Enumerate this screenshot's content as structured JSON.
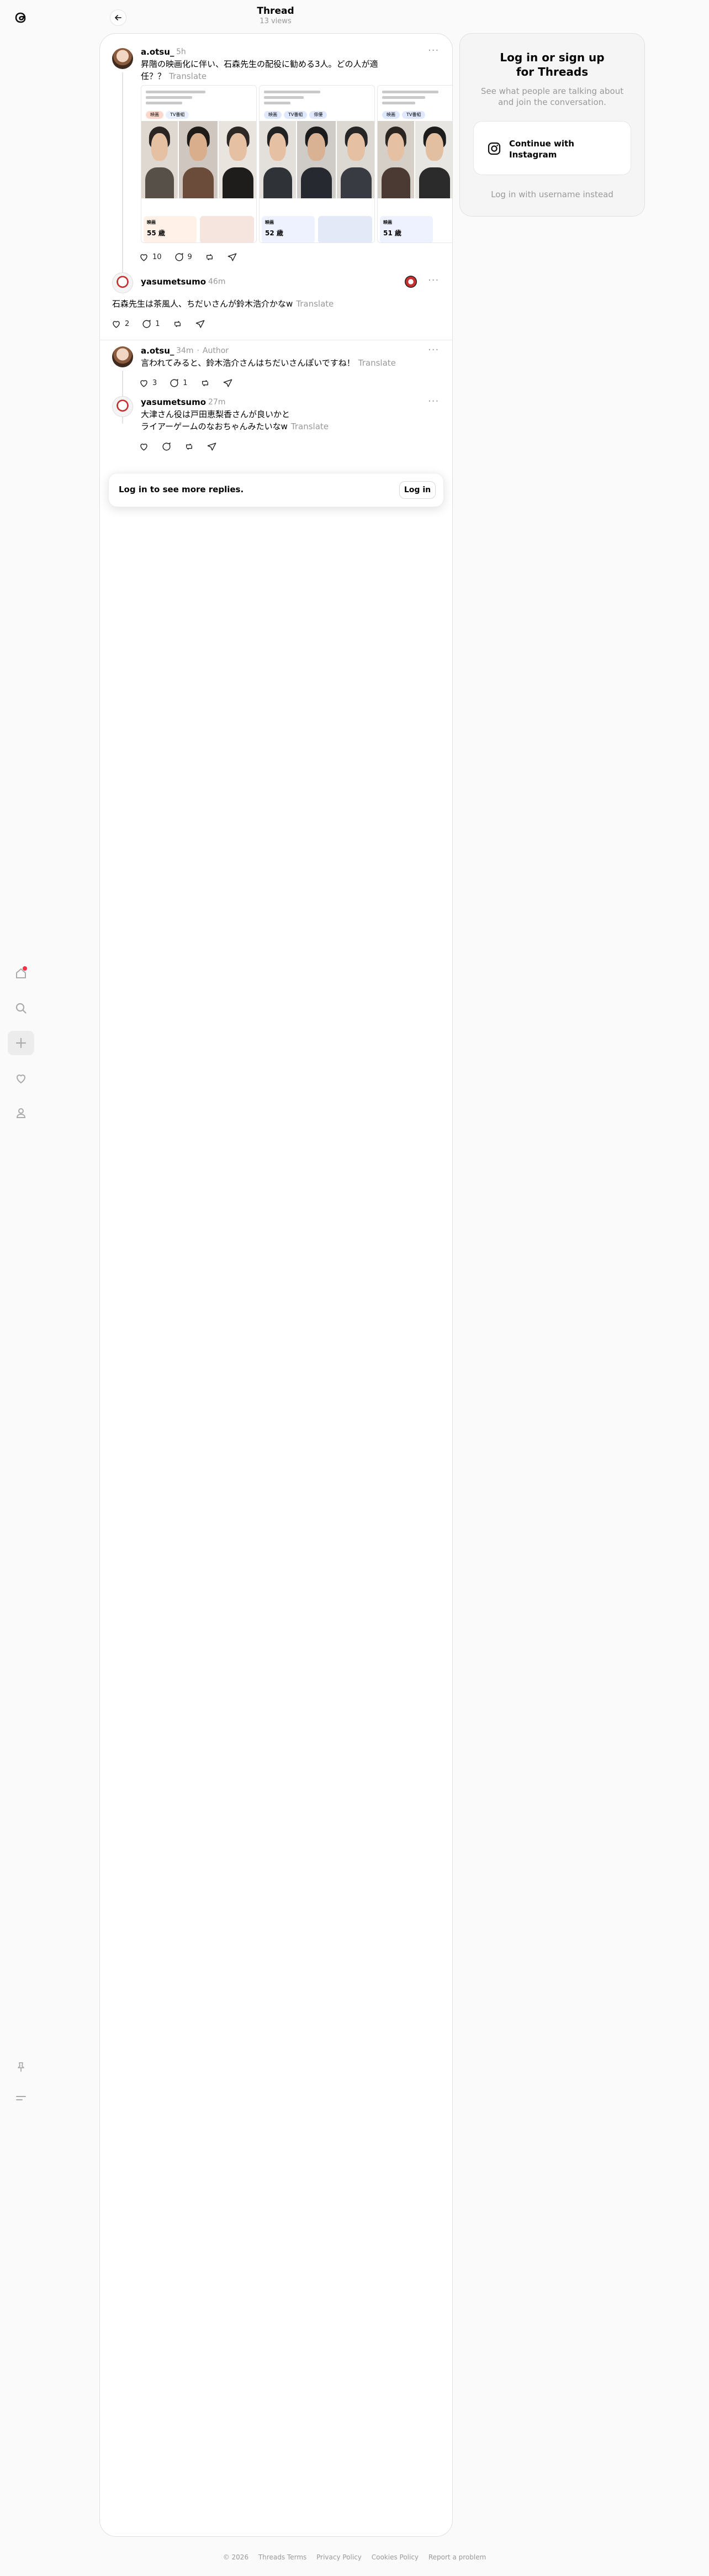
{
  "header": {
    "title": "Thread",
    "views": "13 views"
  },
  "rail": {
    "icons": [
      "threads-logo-icon",
      "home-icon",
      "search-icon",
      "plus-icon",
      "heart-icon",
      "profile-icon",
      "pin-icon",
      "menu-icon"
    ],
    "notification_color": "#ff3040"
  },
  "posts": [
    {
      "user": "a.otsu_",
      "time": "5h",
      "author_tag": "",
      "text_lines": [
        "昇階の映画化に伴い、石森先生の配役に勧める3人。どの人が適",
        "任？？"
      ],
      "translate": "Translate",
      "likes": "10",
      "replies": "9",
      "reposts": "",
      "shares": ""
    },
    {
      "user": "yasumetsumo",
      "time": "46m",
      "author_tag": "",
      "text_lines": [
        "石森先生は茶風人、ちだいさんが鈴木浩介かなw"
      ],
      "translate": "Translate",
      "likes": "2",
      "replies": "1",
      "reposts": "",
      "shares": ""
    },
    {
      "user": "a.otsu_",
      "time": "34m",
      "author_tag": "Author",
      "text_lines": [
        "言われてみると、鈴木浩介さんはちだいさんぽいですね！"
      ],
      "translate": "Translate",
      "likes": "3",
      "replies": "1",
      "reposts": "",
      "shares": ""
    },
    {
      "user": "yasumetsumo",
      "time": "27m",
      "author_tag": "",
      "text_lines": [
        "大津さん役は戸田恵梨香さんが良いかと",
        "ライアーゲームのなおちゃんみたいなw"
      ],
      "translate": "Translate",
      "likes": "",
      "replies": "",
      "reposts": "",
      "shares": ""
    }
  ],
  "image_panels": [
    {
      "pills": [
        "映画",
        "TV番組"
      ],
      "pill_colors": [
        "#ffd7cc",
        "#e8f0ff"
      ],
      "bottom_tag": "映画",
      "bottom_num": "55 歳",
      "bottom_color": "#fff1e8"
    },
    {
      "pills": [
        "映画",
        "TV番組",
        "俳優"
      ],
      "pill_colors": [
        "#dfe8ff",
        "#dfe8ff",
        "#dfe8ff"
      ],
      "bottom_tag": "映画",
      "bottom_num": "52 歳",
      "bottom_color": "#eef2ff"
    },
    {
      "pills": [
        "映画",
        "TV番組"
      ],
      "pill_colors": [
        "#dfe8ff",
        "#dfe8ff"
      ],
      "bottom_tag": "映画",
      "bottom_num": "51 歳",
      "bottom_color": "#eef2ff"
    }
  ],
  "login_bar": {
    "text": "Log in to see more replies.",
    "button": "Log in"
  },
  "side": {
    "title_line1": "Log in or sign up",
    "title_line2": "for Threads",
    "subtitle_line1": "See what people are talking about",
    "subtitle_line2": "and join the conversation.",
    "ig_button_line1": "Continue with",
    "ig_button_line2": "Instagram",
    "alt_link": "Log in with username instead"
  },
  "footer": [
    "© 2026",
    "Threads Terms",
    "Privacy Policy",
    "Cookies Policy",
    "Report a problem"
  ]
}
